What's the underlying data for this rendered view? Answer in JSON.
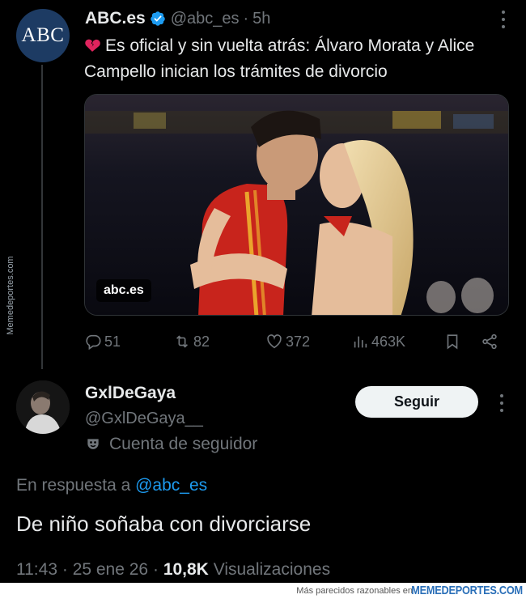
{
  "tweet": {
    "author_name": "ABC.es",
    "author_handle": "@abc_es",
    "separator": "·",
    "time": "5h",
    "avatar_text": "ABC",
    "text": "Es oficial y sin vuelta atrás: Álvaro Morata y Alice Campello inician los trámites de divorcio",
    "emoji_icon": "broken-heart-icon",
    "media_source_label": "abc.es",
    "actions": {
      "replies": "51",
      "retweets": "82",
      "likes": "372",
      "views": "463K"
    }
  },
  "reply": {
    "author_name": "GxlDeGaya",
    "author_handle": "@GxlDeGaya__",
    "follower_label": "Cuenta de seguidor",
    "follow_button": "Seguir",
    "reply_prefix": "En respuesta a",
    "reply_to_handle": "@abc_es",
    "text": "De niño soñaba con divorciarse",
    "time": "11:43",
    "date": "25 ene 26",
    "dot": "·",
    "views_count": "10,8K",
    "views_label": "Visualizaciones"
  },
  "watermark": {
    "side_text": "Memedeportes.com",
    "footer_text": "Más parecidos razonables en",
    "footer_brand": "MEMEDEPORTES.COM"
  },
  "colors": {
    "background": "#000000",
    "text_primary": "#e7e9ea",
    "text_muted": "#71767b",
    "link": "#1d9bf0",
    "verified": "#1d9bf0",
    "abc_avatar": "#1d3b63",
    "broken_heart": "#e0245e"
  }
}
